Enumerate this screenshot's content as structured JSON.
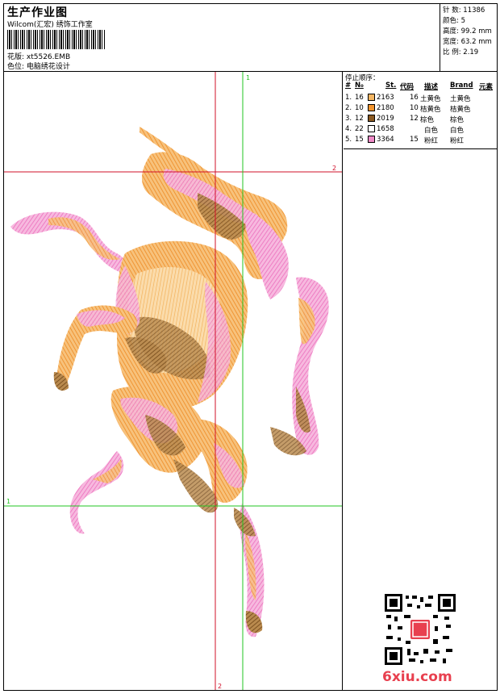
{
  "header": {
    "title": "生产作业图",
    "company": "Wilcom(汇宏) 绣饰工作室",
    "pattern": "花版: xt5526.EMB",
    "color_position": "色位: 电脑绣花设计"
  },
  "stats": [
    {
      "label": "针 数",
      "value": "11386"
    },
    {
      "label": "颜色",
      "value": "5"
    },
    {
      "label": "高度",
      "value": "99.2 mm"
    },
    {
      "label": "宽度",
      "value": "63.2 mm"
    },
    {
      "label": "比 例",
      "value": "2.19"
    }
  ],
  "stop_sequence": {
    "title": "停止顺序：",
    "headers": {
      "hash": "#",
      "no": "N₀",
      "st": "St.",
      "code": "代码",
      "desc": "描述",
      "brand": "Brand",
      "element": "元素"
    },
    "rows": [
      {
        "idx": "1.",
        "no": "16",
        "color": "#f4b663",
        "code": "2163",
        "st": "16",
        "desc": "土黄色",
        "brand": "土黄色"
      },
      {
        "idx": "2.",
        "no": "10",
        "color": "#f2942d",
        "code": "2180",
        "st": "10",
        "desc": "桔黄色",
        "brand": "桔黄色"
      },
      {
        "idx": "3.",
        "no": "12",
        "color": "#8b5a22",
        "code": "2019",
        "st": "12",
        "desc": "棕色",
        "brand": "棕色"
      },
      {
        "idx": "4.",
        "no": "22",
        "color": "#ffffff",
        "code": "1658",
        "st": "",
        "desc": "白色",
        "brand": "白色"
      },
      {
        "idx": "5.",
        "no": "15",
        "color": "#f08bc8",
        "code": "3364",
        "st": "15",
        "desc": "粉红",
        "brand": "粉红"
      }
    ]
  },
  "guides": {
    "red_label_top": "2",
    "red_label_bottom": "2",
    "green_label_top": "1",
    "green_label_left": "1"
  },
  "colors": {
    "pink": "#f08bc8",
    "orange": "#f2942d",
    "tan": "#f4b663",
    "brown": "#8b5a22",
    "guide_red": "#d0102a",
    "guide_green": "#22c422"
  },
  "watermark": "6xiu.com"
}
